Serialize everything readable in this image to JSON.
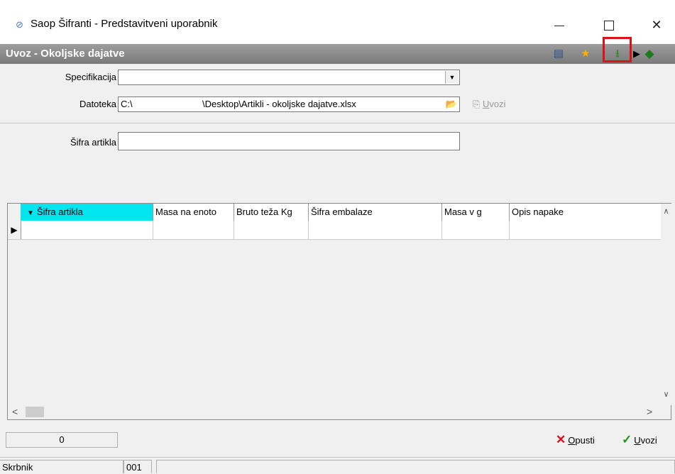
{
  "window": {
    "title": "Saop Šifranti - Predstavitveni uporabnik"
  },
  "header": {
    "title": "Uvoz - Okoljske dajatve",
    "icons": [
      "layout-icon",
      "star-icon",
      "import-icon",
      "arrow-icon",
      "book-icon"
    ]
  },
  "form": {
    "specifikacija_label": "Specifikacija",
    "specifikacija_value": "",
    "datoteka_label": "Datoteka",
    "datoteka_value_prefix": "C:\\",
    "datoteka_value_suffix": "\\Desktop\\Artikli - okoljske dajatve.xlsx",
    "uvozi_disabled_mn": "U",
    "uvozi_disabled_rest": "vozi",
    "sifra_label": "Šifra artikla",
    "sifra_value": ""
  },
  "grid": {
    "columns": [
      "Šifra artikla",
      "Masa na enoto",
      "Bruto teža Kg",
      "Šifra embalaze",
      "Masa v g",
      "Opis napake"
    ],
    "rows": [
      [
        "",
        "",
        "",
        "",
        "",
        ""
      ]
    ]
  },
  "footer": {
    "count": "0",
    "opusti_mn": "O",
    "opusti_rest": "pusti",
    "uvozi_mn": "U",
    "uvozi_rest": "vozi"
  },
  "status": {
    "user": "Skrbnik",
    "code": "001",
    "extra": ""
  },
  "colors": {
    "accent_column": "#00e5f0",
    "highlight_box": "#e0101a",
    "header_bar": "#8a8a8a"
  }
}
